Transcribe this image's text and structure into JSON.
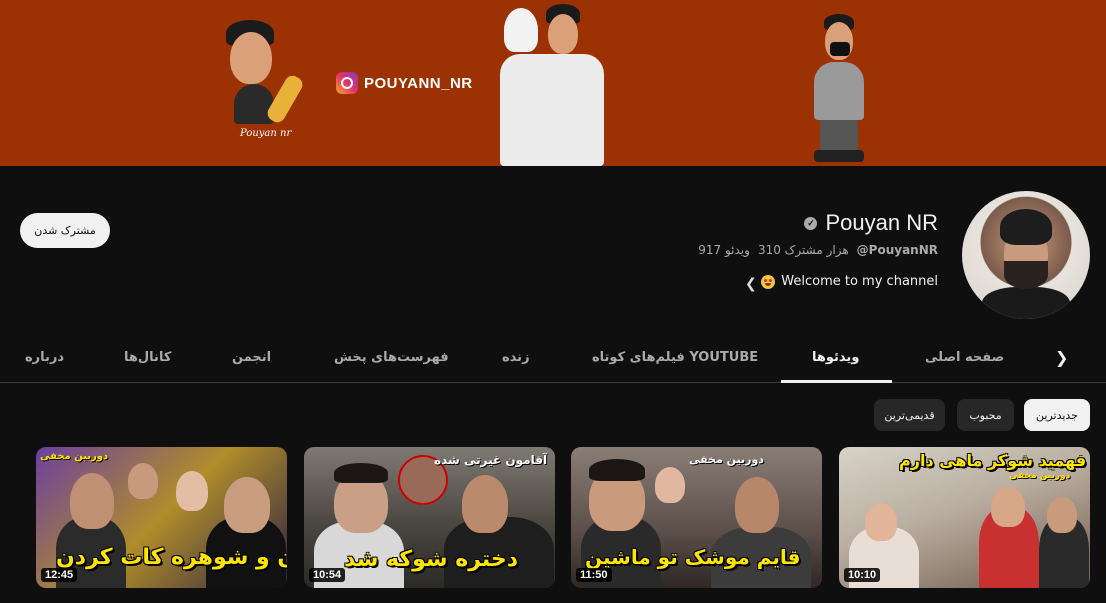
{
  "banner": {
    "instagram_handle": "POUYANN_NR",
    "caption": "Pouyan nr",
    "background_color": "#9c3104"
  },
  "channel": {
    "name": "Pouyan NR",
    "handle": "@PouyanNR",
    "subscribers": "310 هزار مشترک",
    "videos": "917 ویدئو",
    "description": "Welcome to my channel",
    "subscribe_label": "مشترک شدن"
  },
  "tabs": [
    {
      "label": "صفحه اصلی",
      "active": false
    },
    {
      "label": "ویدئوها",
      "active": true
    },
    {
      "label": "فیلم‌های کوتاه YOUTUBE",
      "active": false
    },
    {
      "label": "زنده",
      "active": false
    },
    {
      "label": "فهرست‌های پخش",
      "active": false
    },
    {
      "label": "انجمن",
      "active": false
    },
    {
      "label": "کانال‌ها",
      "active": false
    },
    {
      "label": "درباره",
      "active": false
    }
  ],
  "chips": [
    {
      "label": "جدیدترین",
      "active": true
    },
    {
      "label": "محبوب",
      "active": false
    },
    {
      "label": "قدیمی‌ترین",
      "active": false
    }
  ],
  "videos": [
    {
      "duration": "10:10",
      "overlay": "هانیه فهمید شوکر ماهی دارم",
      "tag": "دوربین مخفی"
    },
    {
      "duration": "11:50",
      "overlay": "قایم موشک تو ماشین",
      "tag": "دوربین مخفی"
    },
    {
      "duration": "10:54",
      "overlay": "دختره شوکه شد",
      "tag": "آقامون غیرتی شده"
    },
    {
      "duration": "12:45",
      "overlay": "زن و شوهره کات کردن",
      "tag": "دوربین مخفی"
    }
  ]
}
